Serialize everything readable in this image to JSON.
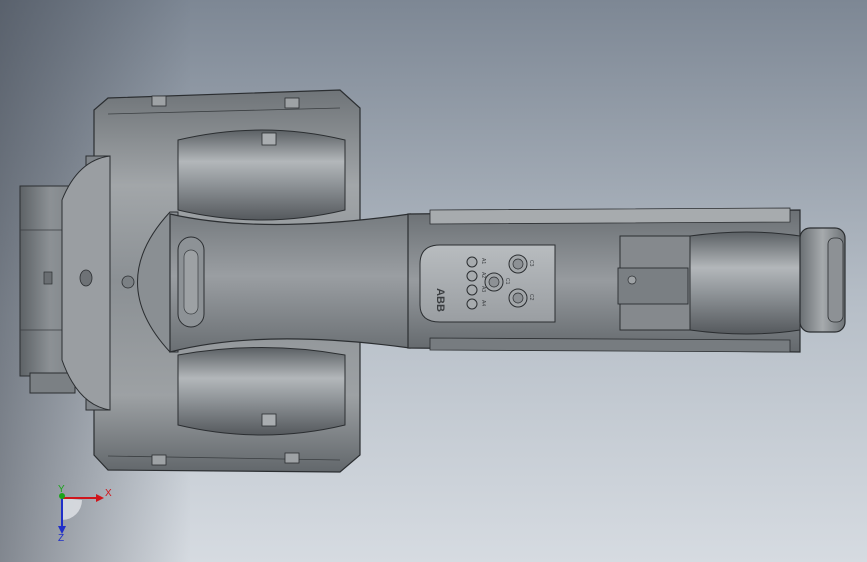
{
  "view": {
    "background_top": "#7d8794",
    "background_bottom": "#d6dbe1",
    "part_color": "#8e9397"
  },
  "robot": {
    "logo": "ABB",
    "ports": {
      "a1": "A1",
      "a2": "A2",
      "a3": "A3",
      "a4": "A4",
      "c1": "C1",
      "c2": "C2",
      "c3": "C3"
    }
  },
  "triad": {
    "x_label": "X",
    "y_label": "Y",
    "z_label": "Z",
    "x_color": "#d0151b",
    "y_color": "#1aa41a",
    "z_color": "#1f2fc8"
  }
}
